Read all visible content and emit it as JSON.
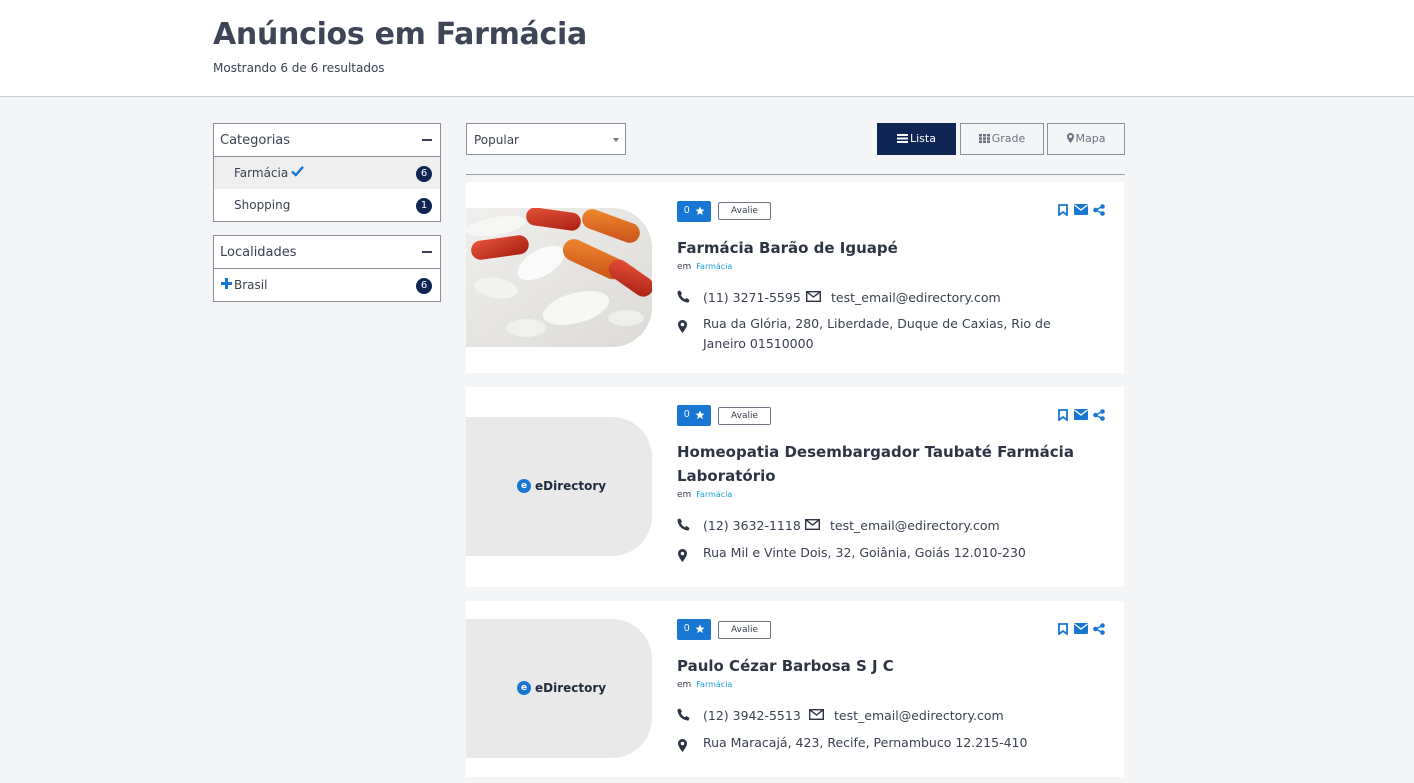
{
  "header": {
    "title": "Anúncios em Farmácia",
    "count": "Mostrando 6 de 6 resultados"
  },
  "filters": {
    "categories": {
      "title": "Categorias",
      "items": [
        {
          "label": "Farmácia",
          "count": "6",
          "active": true
        },
        {
          "label": "Shopping",
          "count": "1",
          "active": false
        }
      ]
    },
    "locations": {
      "title": "Localidades",
      "items": [
        {
          "label": "Brasil",
          "count": "6"
        }
      ]
    }
  },
  "toolbar": {
    "sort_value": "Popular",
    "view_list": "Lista",
    "view_grid": "Grade",
    "view_map": "Mapa",
    "active_view": "Lista"
  },
  "listings": [
    {
      "rating": "0",
      "review_label": "Avalie",
      "title": "Farmácia Barão de Iguapé",
      "in_label": "em",
      "category": "Farmácia",
      "phone": "(11) 3271-5595",
      "email": "test_email@edirectory.com",
      "address": "Rua da Glória, 280, Liberdade, Duque de Caxias, Rio de Janeiro 01510000",
      "image": "pills-photo"
    },
    {
      "rating": "0",
      "review_label": "Avalie",
      "title": "Homeopatia Desembargador Taubaté Farmácia Laboratório",
      "in_label": "em",
      "category": "Farmácia",
      "phone": "(12) 3632-1118",
      "email": "test_email@edirectory.com",
      "address": "Rua Mil e Vinte Dois, 32, Goiânia, Goiás 12.010-230",
      "image": "edirectory-placeholder",
      "logo_text": "eDirectory"
    },
    {
      "rating": "0",
      "review_label": "Avalie",
      "title": "Paulo Cézar Barbosa S J C",
      "in_label": "em",
      "category": "Farmácia",
      "phone": "(12) 3942-5513",
      "email": "test_email@edirectory.com",
      "address": "Rua Maracajá, 423, Recife, Pernambuco 12.215-410",
      "image": "edirectory-placeholder",
      "logo_text": "eDirectory"
    }
  ],
  "colors": {
    "navy": "#0f2654",
    "accent_blue": "#1877d2",
    "link_cyan": "#1a9fd6",
    "background": "#f4f5f7"
  }
}
